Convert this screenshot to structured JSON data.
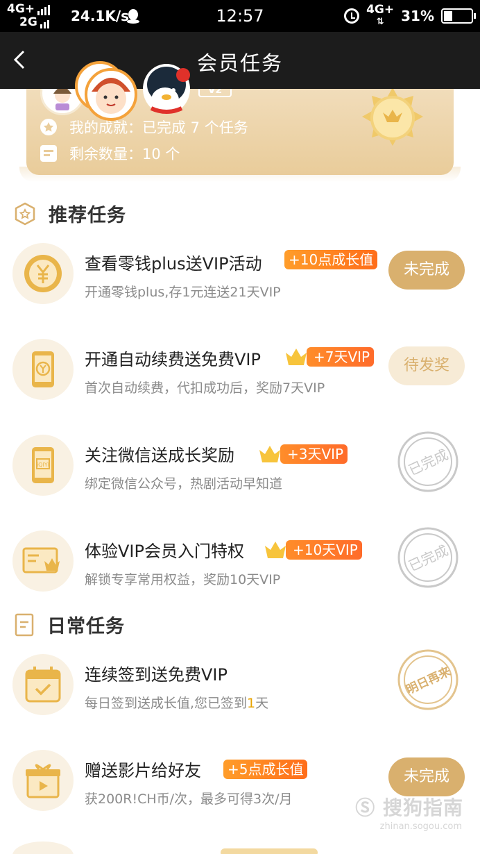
{
  "status_bar": {
    "net_top": "4G+",
    "net_bottom": "2G",
    "speed": "24.1K/s",
    "time": "12:57",
    "net_right_top": "4G+",
    "battery": "31%"
  },
  "nav": {
    "title": "会员任务"
  },
  "card": {
    "level": "V2",
    "achievement_label": "我的成就：已完成 7 个任务",
    "remaining_label": "剩余数量：10 个"
  },
  "sections": {
    "recommended": "推荐任务",
    "daily": "日常任务"
  },
  "tasks": [
    {
      "title": "查看零钱plus送VIP活动",
      "desc": "开通零钱plus,存1元连送21天VIP",
      "badge": "+10点成长值",
      "action": "未完成"
    },
    {
      "title": "开通自动续费送免费VIP",
      "desc": "首次自动续费，代扣成功后，奖励7天VIP",
      "badge": "+7天VIP",
      "action": "待发奖"
    },
    {
      "title": "关注微信送成长奖励",
      "desc": "绑定微信公众号，热剧活动早知道",
      "badge": "+3天VIP",
      "action": "已完成"
    },
    {
      "title": "体验VIP会员入门特权",
      "desc": "解锁专享常用权益，奖励10天VIP",
      "badge": "+10天VIP",
      "action": "已完成"
    },
    {
      "title": "连续签到送免费VIP",
      "desc_pre": "每日签到送成长值,您已签到",
      "desc_num": "1",
      "desc_post": "天",
      "action": "明日再来"
    },
    {
      "title": "赠送影片给好友",
      "desc": "获200R!CH币/次，最多可得3次/月",
      "badge": "+5点成长值",
      "action": "未完成"
    }
  ],
  "watermark": {
    "text": "搜狗指南",
    "sub": "zhinan.sogou.com"
  },
  "colors": {
    "gold": "#d9b06e",
    "orange": "#ff7a2a",
    "nav": "#1c1c1c"
  }
}
